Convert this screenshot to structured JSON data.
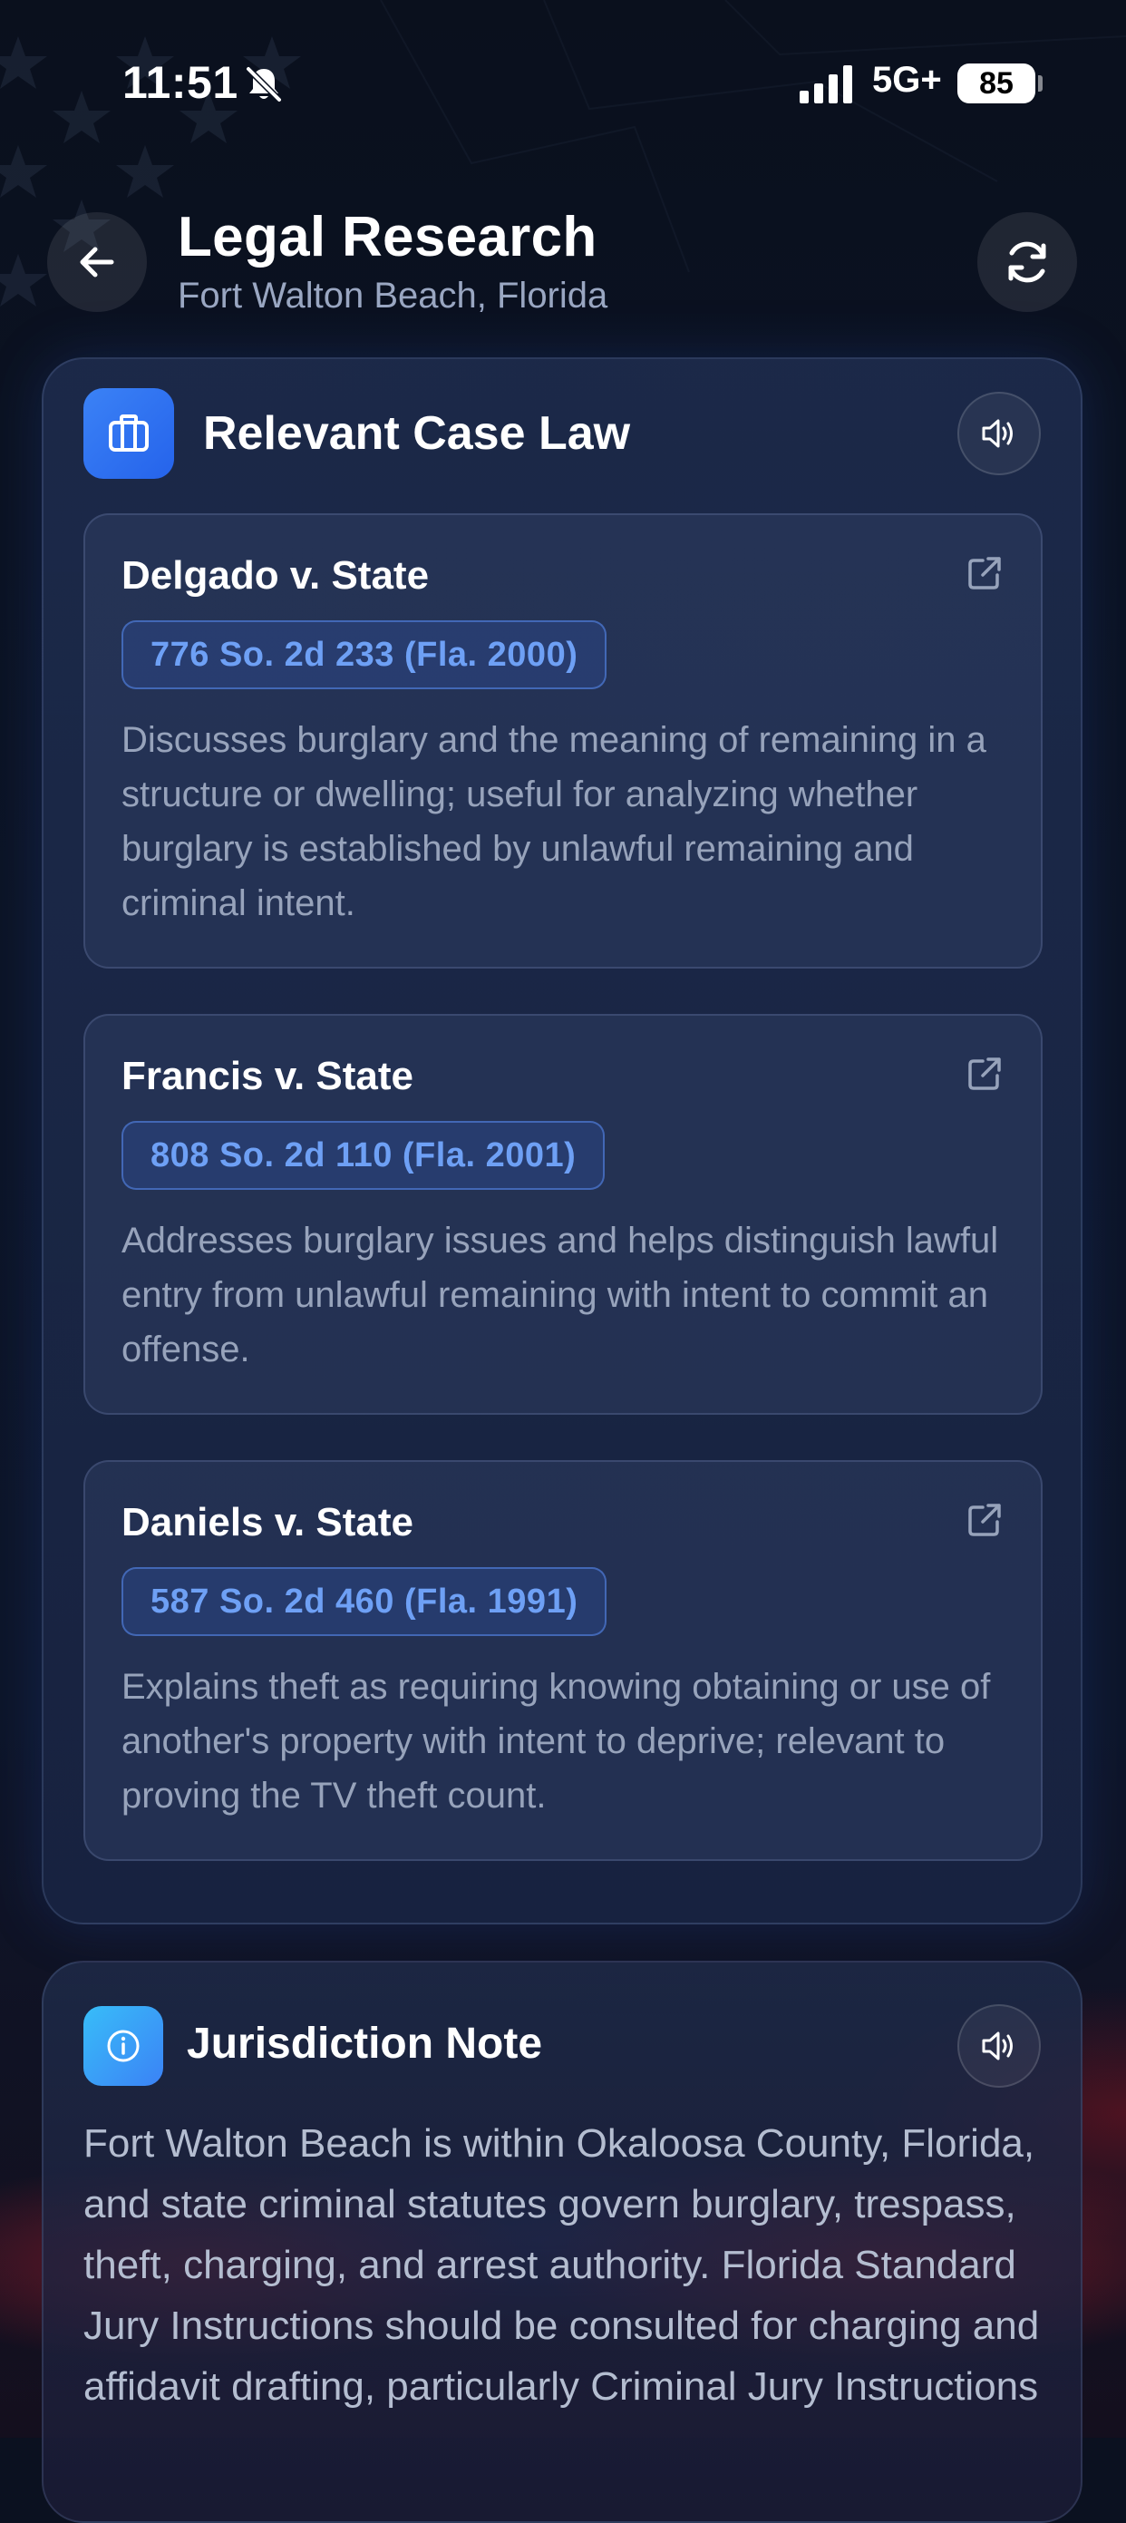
{
  "status_bar": {
    "time": "11:51",
    "network": "5G+",
    "battery": "85"
  },
  "header": {
    "title": "Legal Research",
    "subtitle": "Fort Walton Beach, Florida"
  },
  "case_law": {
    "title": "Relevant Case Law",
    "cases": [
      {
        "name": "Delgado v. State",
        "citation": "776 So. 2d 233 (Fla. 2000)",
        "description": "Discusses burglary and the meaning of remaining in a structure or dwelling; useful for analyzing whether burglary is established by unlawful remaining and criminal intent."
      },
      {
        "name": "Francis v. State",
        "citation": "808 So. 2d 110 (Fla. 2001)",
        "description": "Addresses burglary issues and helps distinguish lawful entry from unlawful remaining with intent to commit an offense."
      },
      {
        "name": "Daniels v. State",
        "citation": "587 So. 2d 460 (Fla. 1991)",
        "description": "Explains theft as requiring knowing obtaining or use of another's property with intent to deprive; relevant to proving the TV theft count."
      }
    ]
  },
  "jurisdiction": {
    "title": "Jurisdiction Note",
    "text": "Fort Walton Beach is within Okaloosa County, Florida, and state criminal statutes govern burglary, trespass, theft, charging, and arrest authority. Florida Standard Jury Instructions should be consulted for charging and affidavit drafting, particularly Criminal Jury Instructions"
  },
  "colors": {
    "accent": "#3b82f6",
    "citation_text": "#6ea0f5",
    "body_text": "#97a3bb"
  }
}
